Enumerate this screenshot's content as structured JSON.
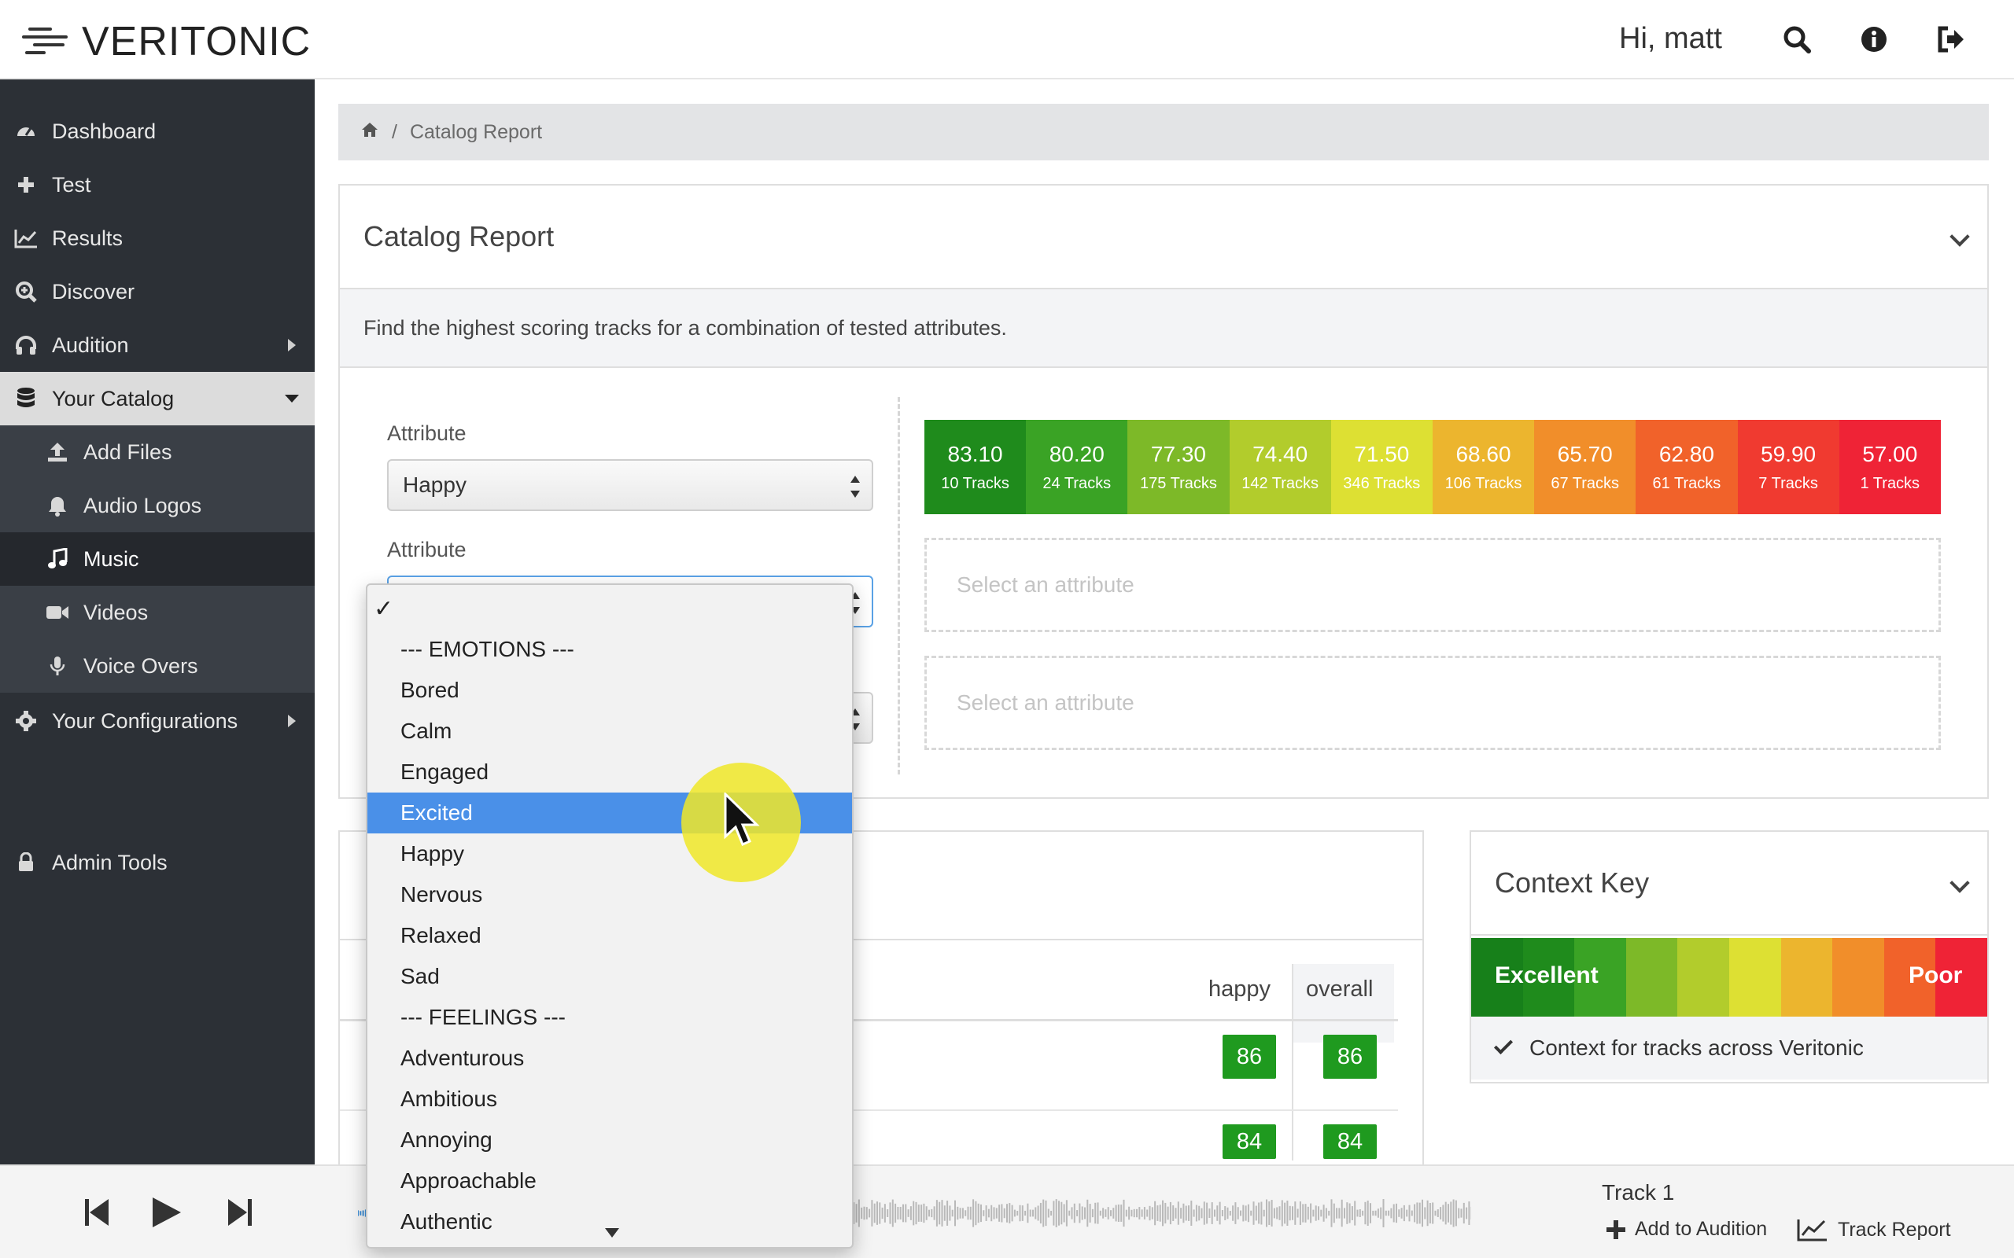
{
  "app": {
    "logo_text": "VERITONIC",
    "greeting": "Hi, matt"
  },
  "topbar_icons": [
    "search-icon",
    "info-icon",
    "sign-out-icon"
  ],
  "sidebar": {
    "items": [
      {
        "label": "Dashboard",
        "icon": "dashboard-icon"
      },
      {
        "label": "Test",
        "icon": "plus-icon"
      },
      {
        "label": "Results",
        "icon": "chart-icon"
      },
      {
        "label": "Discover",
        "icon": "search-plus-icon"
      },
      {
        "label": "Audition",
        "icon": "headphones-icon"
      },
      {
        "label": "Your Catalog",
        "icon": "database-icon"
      },
      {
        "label": "Add Files",
        "icon": "upload-icon"
      },
      {
        "label": "Audio Logos",
        "icon": "bell-icon"
      },
      {
        "label": "Music",
        "icon": "music-icon"
      },
      {
        "label": "Videos",
        "icon": "video-icon"
      },
      {
        "label": "Voice Overs",
        "icon": "microphone-icon"
      },
      {
        "label": "Your Configurations",
        "icon": "gear-icon"
      },
      {
        "label": "Admin Tools",
        "icon": "lock-icon"
      }
    ]
  },
  "breadcrumb": {
    "home_icon": "home-icon",
    "separator": "/",
    "current": "Catalog Report"
  },
  "catalog_report": {
    "title": "Catalog Report",
    "description": "Find the highest scoring tracks for a combination of tested attributes.",
    "attribute_label_1": "Attribute",
    "attribute_value_1": "Happy",
    "attribute_label_2": "Attribute",
    "attribute_value_2": "",
    "drop_placeholder_1": "Select an attribute",
    "drop_placeholder_2": "Select an attribute",
    "scores": [
      {
        "value": "83.10",
        "tracks": "10 Tracks",
        "color": "#1f8b1c"
      },
      {
        "value": "80.20",
        "tracks": "24 Tracks",
        "color": "#3aa325"
      },
      {
        "value": "77.30",
        "tracks": "175 Tracks",
        "color": "#7db928"
      },
      {
        "value": "74.40",
        "tracks": "142 Tracks",
        "color": "#b2cc2c"
      },
      {
        "value": "71.50",
        "tracks": "346 Tracks",
        "color": "#dde033"
      },
      {
        "value": "68.60",
        "tracks": "106 Tracks",
        "color": "#ecb52e"
      },
      {
        "value": "65.70",
        "tracks": "67 Tracks",
        "color": "#f18e2a"
      },
      {
        "value": "62.80",
        "tracks": "61 Tracks",
        "color": "#f1622a"
      },
      {
        "value": "59.90",
        "tracks": "7 Tracks",
        "color": "#f03a30"
      },
      {
        "value": "57.00",
        "tracks": "1 Tracks",
        "color": "#ef2336"
      }
    ]
  },
  "results_table": {
    "columns": [
      "happy",
      "overall"
    ],
    "rows": [
      {
        "happy": "86",
        "overall": "86"
      },
      {
        "happy": "84",
        "overall": "84"
      }
    ]
  },
  "context_key": {
    "title": "Context Key",
    "excellent_label": "Excellent",
    "poor_label": "Poor",
    "gradient": [
      "#17801a",
      "#1f8b1c",
      "#3aa325",
      "#7db928",
      "#b2cc2c",
      "#dde033",
      "#ecb52e",
      "#f18e2a",
      "#f1622a",
      "#ef2336"
    ],
    "footer": "Context for tracks across Veritonic"
  },
  "dropdown": {
    "options": [
      {
        "label": "✓",
        "kind": "tick"
      },
      {
        "label": "--- EMOTIONS ---",
        "kind": "group"
      },
      {
        "label": "Bored"
      },
      {
        "label": "Calm"
      },
      {
        "label": "Engaged"
      },
      {
        "label": "Excited",
        "selected": true
      },
      {
        "label": "Happy"
      },
      {
        "label": "Nervous"
      },
      {
        "label": "Relaxed"
      },
      {
        "label": "Sad"
      },
      {
        "label": "--- FEELINGS ---",
        "kind": "group"
      },
      {
        "label": "Adventurous"
      },
      {
        "label": "Ambitious"
      },
      {
        "label": "Annoying"
      },
      {
        "label": "Approachable"
      },
      {
        "label": "Authentic"
      }
    ]
  },
  "player": {
    "track_name": "Track 1",
    "add_to_audition": "Add to Audition",
    "track_report": "Track Report",
    "progress": 0.33
  }
}
